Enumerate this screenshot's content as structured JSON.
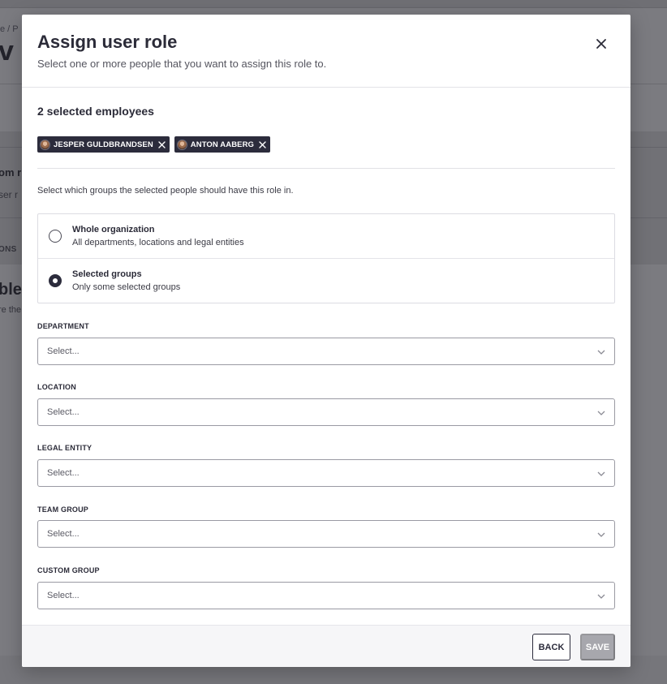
{
  "background": {
    "breadcrumb": "e  /  P",
    "title": "v r",
    "text1": "om r",
    "text2": "ser r",
    "text3": "ONS",
    "text4": "ble",
    "text5": "re the"
  },
  "modal": {
    "title": "Assign user role",
    "subtitle": "Select one or more people that you want to assign this role to.",
    "selected_heading": "2 selected employees",
    "chips": [
      {
        "label": "JESPER GULDBRANDSEN"
      },
      {
        "label": "ANTON AABERG"
      }
    ],
    "instruction": "Select which groups the selected people should have this role in.",
    "scope_options": [
      {
        "title": "Whole organization",
        "description": "All departments, locations and legal entities",
        "checked": false
      },
      {
        "title": "Selected groups",
        "description": "Only some selected groups",
        "checked": true
      }
    ],
    "fields": [
      {
        "label": "DEPARTMENT",
        "placeholder": "Select..."
      },
      {
        "label": "LOCATION",
        "placeholder": "Select..."
      },
      {
        "label": "LEGAL ENTITY",
        "placeholder": "Select..."
      },
      {
        "label": "TEAM GROUP",
        "placeholder": "Select..."
      },
      {
        "label": "CUSTOM GROUP",
        "placeholder": "Select..."
      }
    ],
    "footer": {
      "back_label": "BACK",
      "save_label": "SAVE"
    }
  },
  "colors": {
    "primary": "#2c2c3c",
    "disabled": "#a7a7ad",
    "overlay": "#7b7b80"
  }
}
